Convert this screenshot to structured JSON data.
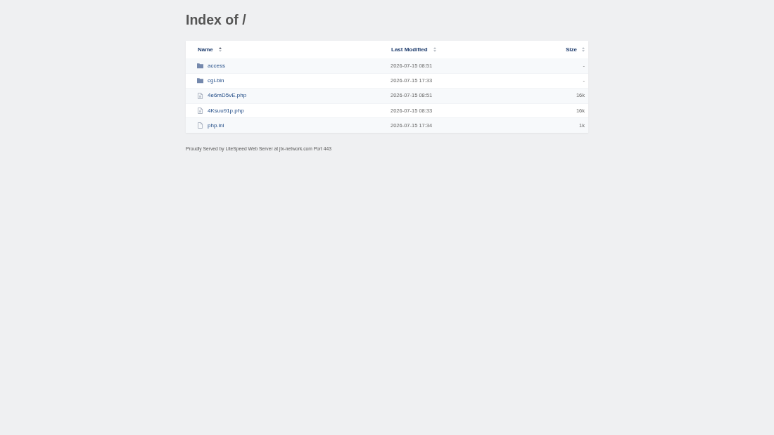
{
  "title": "Index of /",
  "table": {
    "columns": [
      {
        "label": "Name",
        "sorted": true
      },
      {
        "label": "Last Modified",
        "sorted": false
      },
      {
        "label": "Size",
        "sorted": false
      }
    ],
    "rows": [
      {
        "kind": "folder",
        "name": "access",
        "modified": "2026-07-15 08:51",
        "size": "-"
      },
      {
        "kind": "folder",
        "name": "cgi-bin",
        "modified": "2026-07-15 17:33",
        "size": "-"
      },
      {
        "kind": "document",
        "name": "4e6mD5vE.php",
        "modified": "2026-07-15 08:51",
        "size": "16k"
      },
      {
        "kind": "document",
        "name": "4Ksuu91p.php",
        "modified": "2026-07-15 08:33",
        "size": "16k"
      },
      {
        "kind": "file",
        "name": "php.ini",
        "modified": "2026-07-15 17:34",
        "size": "1k"
      }
    ]
  },
  "footer": "Proudly Served by LiteSpeed Web Server at jtx-network.com Port 443"
}
